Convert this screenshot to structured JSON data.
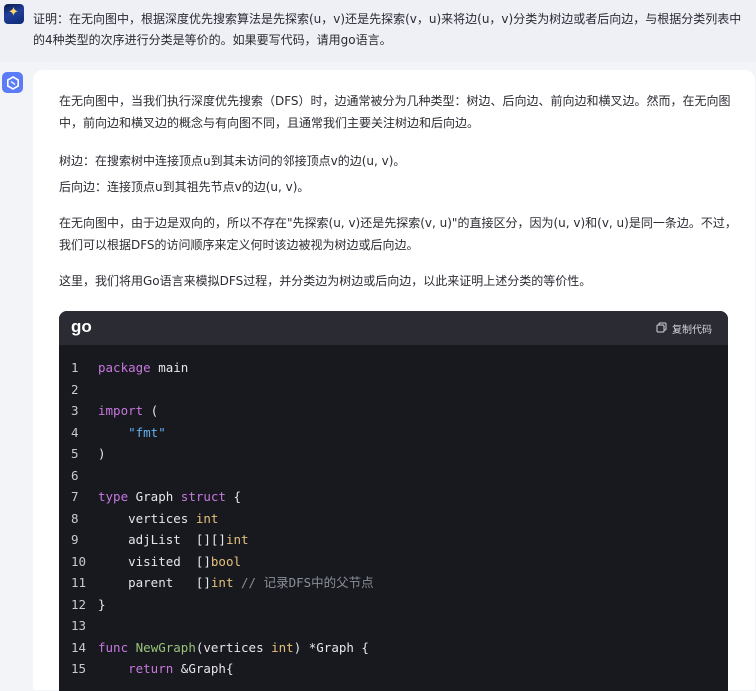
{
  "user_message": {
    "text": "证明：在无向图中，根据深度优先搜索算法是先探索(u，v)还是先探索(v，u)来将边(u，v)分类为树边或者后向边，与根据分类列表中的4种类型的次序进行分类是等价的。如果要写代码，请用go语言。"
  },
  "answer": {
    "p1": "在无向图中，当我们执行深度优先搜索（DFS）时，边通常被分为几种类型：树边、后向边、前向边和横叉边。然而，在无向图中，前向边和横叉边的概念与有向图不同，且通常我们主要关注树边和后向边。",
    "p2": "树边：在搜索树中连接顶点u到其未访问的邻接顶点v的边(u, v)。",
    "p3": "后向边：连接顶点u到其祖先节点v的边(u, v)。",
    "p4": "在无向图中，由于边是双向的，所以不存在\"先探索(u, v)还是先探索(v, u)\"的直接区分，因为(u, v)和(v, u)是同一条边。不过，我们可以根据DFS的访问顺序来定义何时该边被视为树边或后向边。",
    "p5": "这里，我们将用Go语言来模拟DFS过程，并分类边为树边或后向边，以此来证明上述分类的等价性。"
  },
  "code_block": {
    "language": "go",
    "copy_label": "复制代码",
    "lines": [
      {
        "n": "1",
        "tokens": [
          {
            "t": "package",
            "c": "kw"
          },
          {
            "t": " main",
            "c": ""
          }
        ]
      },
      {
        "n": "2",
        "tokens": []
      },
      {
        "n": "3",
        "tokens": [
          {
            "t": "import",
            "c": "kw"
          },
          {
            "t": " (",
            "c": ""
          }
        ]
      },
      {
        "n": "4",
        "tokens": [
          {
            "t": "    ",
            "c": ""
          },
          {
            "t": "\"fmt\"",
            "c": "str"
          }
        ]
      },
      {
        "n": "5",
        "tokens": [
          {
            "t": ")",
            "c": ""
          }
        ]
      },
      {
        "n": "6",
        "tokens": []
      },
      {
        "n": "7",
        "tokens": [
          {
            "t": "type",
            "c": "kw"
          },
          {
            "t": " Graph ",
            "c": ""
          },
          {
            "t": "struct",
            "c": "kw"
          },
          {
            "t": " {",
            "c": ""
          }
        ]
      },
      {
        "n": "8",
        "tokens": [
          {
            "t": "    vertices ",
            "c": ""
          },
          {
            "t": "int",
            "c": "type"
          }
        ]
      },
      {
        "n": "9",
        "tokens": [
          {
            "t": "    adjList  [][]",
            "c": ""
          },
          {
            "t": "int",
            "c": "type"
          }
        ]
      },
      {
        "n": "10",
        "tokens": [
          {
            "t": "    visited  []",
            "c": ""
          },
          {
            "t": "bool",
            "c": "type"
          }
        ]
      },
      {
        "n": "11",
        "tokens": [
          {
            "t": "    parent   []",
            "c": ""
          },
          {
            "t": "int",
            "c": "type"
          },
          {
            "t": " // 记录DFS中的父节点",
            "c": "com"
          }
        ]
      },
      {
        "n": "12",
        "tokens": [
          {
            "t": "}",
            "c": ""
          }
        ]
      },
      {
        "n": "13",
        "tokens": []
      },
      {
        "n": "14",
        "tokens": [
          {
            "t": "func",
            "c": "kw"
          },
          {
            "t": " ",
            "c": ""
          },
          {
            "t": "NewGraph",
            "c": "fn"
          },
          {
            "t": "(vertices ",
            "c": ""
          },
          {
            "t": "int",
            "c": "type"
          },
          {
            "t": ") *Graph {",
            "c": ""
          }
        ]
      },
      {
        "n": "15",
        "tokens": [
          {
            "t": "    ",
            "c": ""
          },
          {
            "t": "return",
            "c": "kw"
          },
          {
            "t": " &Graph{",
            "c": ""
          }
        ]
      }
    ]
  },
  "icons": {
    "user_avatar": "user-avatar-icon",
    "ai_avatar": "assistant-logo-icon",
    "copy": "copy-icon"
  },
  "colors": {
    "accent": "#5b7cf6",
    "code_bg": "#18181f",
    "code_header_bg": "#2b2c33"
  }
}
